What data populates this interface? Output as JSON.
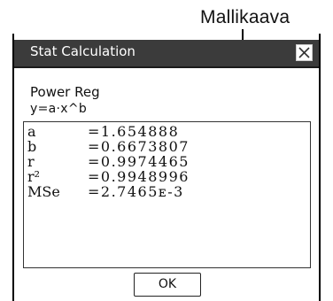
{
  "callout": {
    "label": "Mallikaava"
  },
  "dialog": {
    "title": "Stat Calculation",
    "close_icon": "close-icon",
    "regression_type": "Power Reg",
    "formula": "y=a·x^b",
    "results": [
      {
        "name": "a",
        "value": "=1.654888"
      },
      {
        "name": "b",
        "value": "=0.6673807"
      },
      {
        "name": "r",
        "value": "=0.9974465"
      },
      {
        "name": "r²",
        "value": "=0.9948996"
      },
      {
        "name": "MSe",
        "value": "=2.7465ᴇ-3"
      }
    ],
    "ok_label": "OK"
  },
  "colors": {
    "titlebar": "#3b3b3b",
    "title_text": "#ffffff",
    "frame": "#000000"
  }
}
